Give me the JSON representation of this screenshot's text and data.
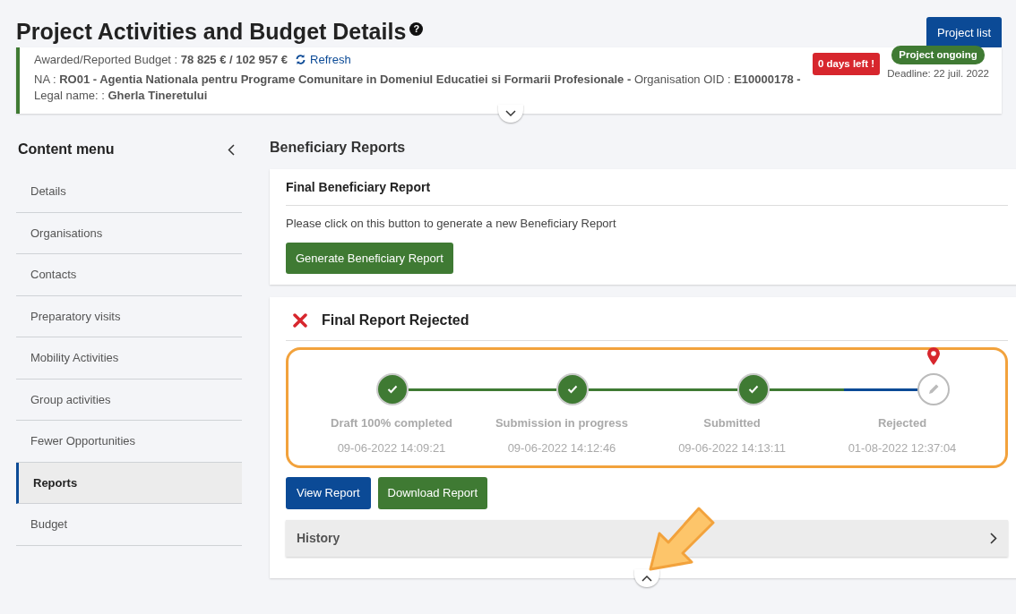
{
  "page": {
    "title": "Project Activities and Budget Details",
    "help": "?",
    "project_list_button": "Project list"
  },
  "summary": {
    "budget_line": "Awarded/Reported Budget : **78 825 € / 102 957 €**",
    "refresh": "Refresh",
    "org_line": "NA : **RO01 - Agentia Nationala pentru Programe Comunitare in Domeniul Educatiei si Formarii Profesionale -** Organisation OID : **E10000178 -** Legal name: : **Gherla Tineretului**",
    "days_left": "0 days left !",
    "status": "Project ongoing",
    "deadline": "Deadline: 22 juil. 2022",
    "expanded": false
  },
  "sidebar": {
    "title": "Content menu",
    "items": [
      {
        "label": "Details",
        "selected": false
      },
      {
        "label": "Organisations",
        "selected": false
      },
      {
        "label": "Contacts",
        "selected": false
      },
      {
        "label": "Preparatory visits",
        "selected": false
      },
      {
        "label": "Mobility Activities",
        "selected": false
      },
      {
        "label": "Group activities",
        "selected": false
      },
      {
        "label": "Fewer Opportunities",
        "selected": false
      },
      {
        "label": "Reports",
        "selected": true
      },
      {
        "label": "Budget",
        "selected": false
      }
    ]
  },
  "section_title": "Beneficiary Reports",
  "final_report_card": {
    "title": "Final Beneficiary Report",
    "text": "Please click on this button to generate a new Beneficiary Report",
    "button": "Generate Beneficiary Report"
  },
  "status_card": {
    "title": "Final Report Rejected",
    "steps": [
      {
        "label": "Draft 100% completed",
        "date": "09-06-2022 14:09:21",
        "kind": "done"
      },
      {
        "label": "Submission in progress",
        "date": "09-06-2022 14:12:46",
        "kind": "done"
      },
      {
        "label": "Submitted",
        "date": "09-06-2022 14:13:11",
        "kind": "done"
      },
      {
        "label": "Rejected",
        "date": "01-08-2022 12:37:04",
        "kind": "current"
      }
    ],
    "buttons": [
      {
        "label": "View Report",
        "kind": "primary"
      },
      {
        "label": "Download Report",
        "kind": "success"
      }
    ],
    "history": {
      "label": "History",
      "expanded": false
    }
  },
  "annotations": {
    "highlight_frame": true,
    "pointer_arrow": true
  }
}
